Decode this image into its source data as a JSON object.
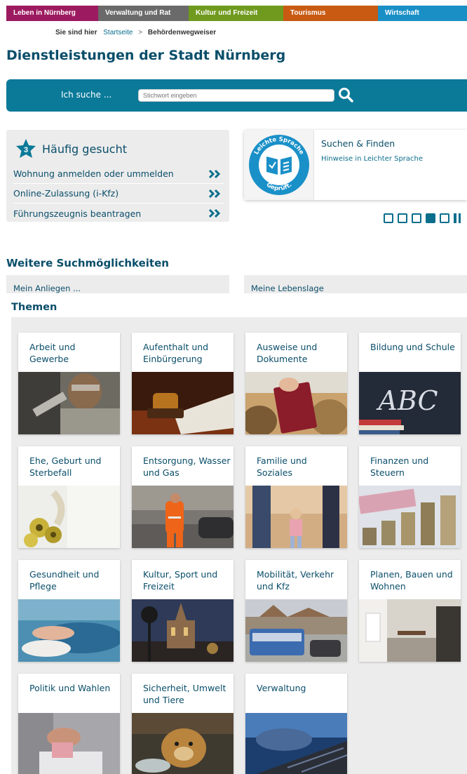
{
  "nav": {
    "items": [
      {
        "label": "Leben in Nürnberg",
        "color": "#9c1a5f"
      },
      {
        "label": "Verwaltung und Rat",
        "color": "#6a6a6a"
      },
      {
        "label": "Kultur und Freizeit",
        "color": "#6f9a1e"
      },
      {
        "label": "Tourismus",
        "color": "#c85a12"
      },
      {
        "label": "Wirtschaft",
        "color": "#1a8fc6"
      }
    ]
  },
  "breadcrumb": {
    "lead": "Sie sind hier",
    "home": "Startseite",
    "separator": ">",
    "current": "Behördenwegweiser"
  },
  "page_title": "Dienstleistungen der Stadt Nürnberg",
  "search": {
    "label": "Ich suche ...",
    "placeholder": "Stichwort eingeben",
    "icon": "search-icon"
  },
  "faq": {
    "badge": "3",
    "title": "Häufig gesucht",
    "items": [
      "Wohnung anmelden oder ummelden",
      "Online-Zulassung (i-Kfz)",
      "Führungszeugnis beantragen"
    ]
  },
  "carousel": {
    "seal_top": "Leichte Sprache",
    "seal_bottom": "Geprüft.",
    "title": "Suchen & Finden",
    "link": "Hinweise in Leichter Sprache",
    "slide_count": 5,
    "active_index": 3
  },
  "more": {
    "title": "Weitere Suchmöglichkeiten",
    "tab_anliegen": "Mein Anliegen ...",
    "tab_lebenslage": "Meine Lebenslage"
  },
  "themen": {
    "title": "Themen",
    "tiles": [
      "Arbeit und Gewerbe",
      "Aufenthalt und Einbürgerung",
      "Ausweise und Dokumente",
      "Bildung und Schule",
      "Ehe, Geburt und Sterbefall",
      "Entsorgung, Wasser und Gas",
      "Familie und Soziales",
      "Finanzen und Steuern",
      "Gesundheit und Pflege",
      "Kultur, Sport und Freizeit",
      "Mobilität, Verkehr und Kfz",
      "Planen, Bauen und Wohnen",
      "Politik und Wahlen",
      "Sicherheit, Umwelt und Tiere",
      "Verwaltung"
    ],
    "abc_text": "ABC"
  },
  "colors": {
    "accent": "#0b7a99",
    "title_blue": "#0a4e6a"
  }
}
